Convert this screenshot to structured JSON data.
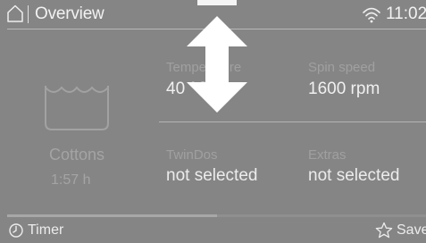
{
  "header": {
    "title": "Overview",
    "time": "11:02",
    "home_icon": "home-icon",
    "wifi_icon": "wifi-icon"
  },
  "program": {
    "icon": "washtub-icon",
    "name": "Cottons",
    "duration": "1:57  h"
  },
  "fields": {
    "temperature": {
      "label": "Temperature",
      "value": "40 °C"
    },
    "spin_speed": {
      "label": "Spin speed",
      "value": "1600 rpm"
    },
    "twindos": {
      "label": "TwinDos",
      "value": "not selected"
    },
    "extras": {
      "label": "Extras",
      "value": "not selected"
    }
  },
  "overlay": {
    "icon": "vertical-double-arrow-icon"
  },
  "progress": {
    "fraction": 0.5
  },
  "footer": {
    "timer_label": "Timer",
    "save_label": "Save"
  },
  "colors": {
    "background": "#858585",
    "text": "#f0f0f0",
    "dimmed_text": "#a4a4a4",
    "accent_white": "#ffffff"
  }
}
